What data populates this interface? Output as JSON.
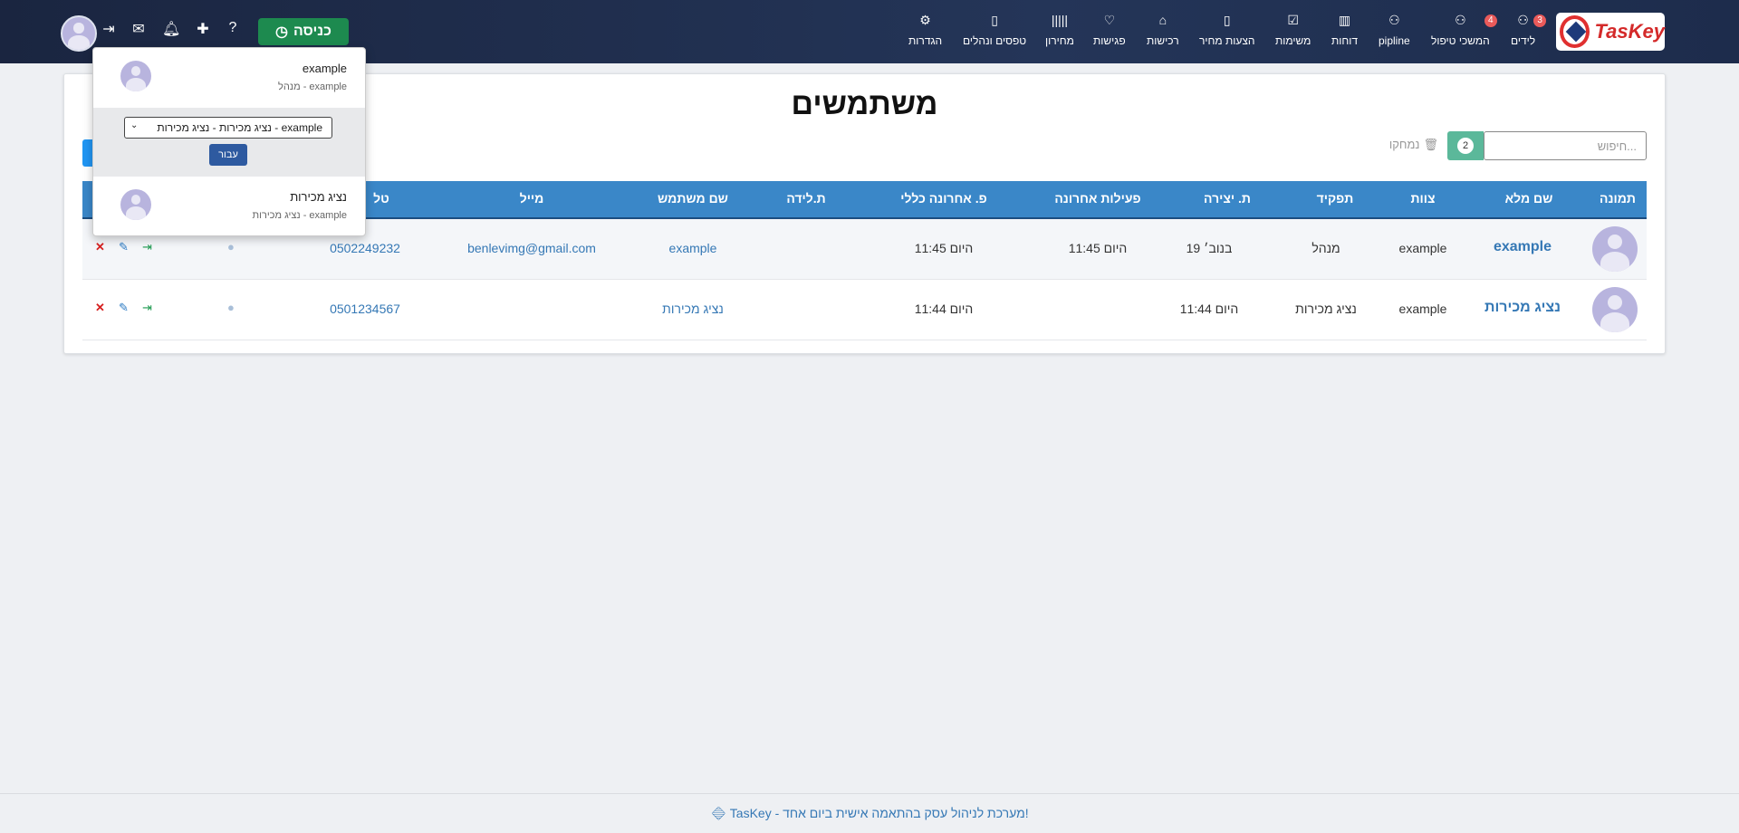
{
  "brand": {
    "logo_text": "TasKey"
  },
  "nav": [
    {
      "label": "לידים",
      "icon": "user-icon",
      "badge": "3"
    },
    {
      "label": "המשכי טיפול",
      "icon": "user-icon",
      "badge": "4"
    },
    {
      "label": "pipline",
      "icon": "user-icon",
      "badge": ""
    },
    {
      "label": "דוחות",
      "icon": "bar-chart-icon",
      "badge": ""
    },
    {
      "label": "משימות",
      "icon": "checkbox-icon",
      "badge": ""
    },
    {
      "label": "הצעות מחיר",
      "icon": "document-icon",
      "badge": ""
    },
    {
      "label": "רכישות",
      "icon": "cart-icon",
      "badge": ""
    },
    {
      "label": "פגישות",
      "icon": "handshake-icon",
      "badge": ""
    },
    {
      "label": "מחירון",
      "icon": "barcode-icon",
      "badge": ""
    },
    {
      "label": "טפסים ונהלים",
      "icon": "book-icon",
      "badge": ""
    },
    {
      "label": "הגדרות",
      "icon": "gear-icon",
      "badge": ""
    }
  ],
  "toolbar": {
    "enter_label": "כניסה"
  },
  "page": {
    "title": "משתמשים",
    "search_placeholder": "חיפוש...",
    "count": "2",
    "deleted_label": "נמחקו"
  },
  "table": {
    "headers": [
      "תמונה",
      "שם מלא",
      "צוות",
      "תפקיד",
      "ת. יצירה",
      "פעילות אחרונה",
      "פ. אחרונה כללי",
      "ת.לידה",
      "שם משתמש",
      "מייל",
      "טל"
    ],
    "rows": [
      {
        "full_name": "example",
        "team": "example",
        "role": "מנהל",
        "created": "19 בנוב׳",
        "last_activity": "היום 11:45",
        "last_general": "היום 11:45",
        "birthday": "",
        "username": "example",
        "email": "benlevimg@gmail.com",
        "phone": "0502249232"
      },
      {
        "full_name": "נציג מכירות",
        "team": "example",
        "role": "נציג מכירות",
        "created": "היום 11:44",
        "last_activity": "",
        "last_general": "היום 11:44",
        "birthday": "",
        "username": "נציג מכירות",
        "email": "",
        "phone": "0501234567"
      }
    ]
  },
  "user_menu": {
    "current": {
      "name": "example",
      "sub": "מנהל - example"
    },
    "select_value": "נציג מכירות - נציג מכירות - example",
    "go_label": "עבור",
    "other": {
      "name": "נציג מכירות",
      "sub": "נציג מכירות - example"
    }
  },
  "footer": {
    "text": "TasKey - מערכת לניהול עסק בהתאמה אישית ביום אחד!"
  }
}
